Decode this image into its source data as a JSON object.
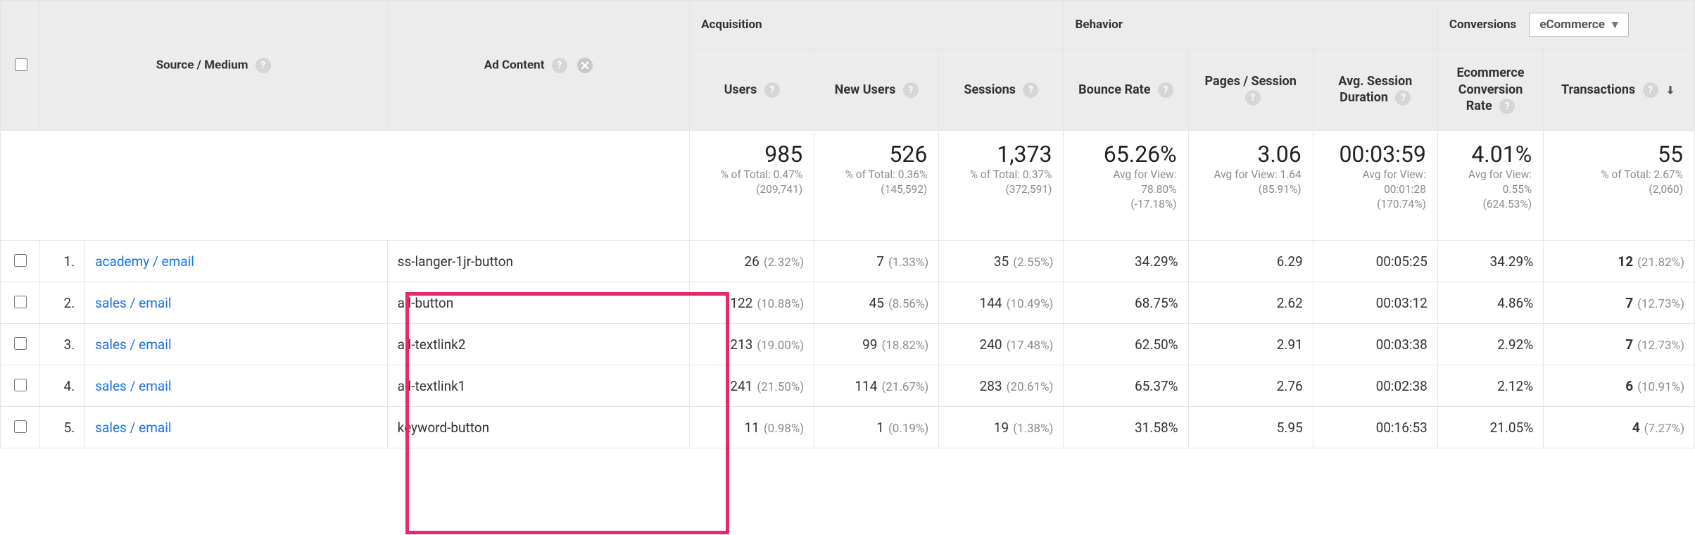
{
  "headers": {
    "checkbox": "",
    "source_medium": "Source / Medium",
    "ad_content": "Ad Content",
    "acquisition": "Acquisition",
    "behavior": "Behavior",
    "conversions": "Conversions",
    "conversions_dropdown": "eCommerce",
    "users": "Users",
    "new_users": "New Users",
    "sessions": "Sessions",
    "bounce_rate": "Bounce Rate",
    "pages_session": "Pages / Session",
    "avg_duration": "Avg. Session Duration",
    "ecr": "Ecommerce Conversion Rate",
    "transactions": "Transactions"
  },
  "totals": {
    "users": {
      "big": "985",
      "sub1": "% of Total: 0.47%",
      "sub2": "(209,741)"
    },
    "new_users": {
      "big": "526",
      "sub1": "% of Total: 0.36%",
      "sub2": "(145,592)"
    },
    "sessions": {
      "big": "1,373",
      "sub1": "% of Total: 0.37%",
      "sub2": "(372,591)"
    },
    "bounce": {
      "big": "65.26%",
      "sub1": "Avg for View: 78.80%",
      "sub2": "(-17.18%)"
    },
    "pages": {
      "big": "3.06",
      "sub1": "Avg for View: 1.64",
      "sub2": "(85.91%)"
    },
    "duration": {
      "big": "00:03:59",
      "sub1": "Avg for View: 00:01:28",
      "sub2": "(170.74%)"
    },
    "ecr": {
      "big": "4.01%",
      "sub1": "Avg for View: 0.55%",
      "sub2": "(624.53%)"
    },
    "trans": {
      "big": "55",
      "sub1": "% of Total: 2.67%",
      "sub2": "(2,060)"
    }
  },
  "rows": [
    {
      "n": "1.",
      "source": "academy / email",
      "ad": "ss-langer-1jr-button",
      "users": "26",
      "users_p": "(2.32%)",
      "new": "7",
      "new_p": "(1.33%)",
      "sess": "35",
      "sess_p": "(2.55%)",
      "bounce": "34.29%",
      "pages": "6.29",
      "dur": "00:05:25",
      "ecr": "34.29%",
      "trans": "12",
      "trans_p": "(21.82%)"
    },
    {
      "n": "2.",
      "source": "sales / email",
      "ad": "all-button",
      "users": "122",
      "users_p": "(10.88%)",
      "new": "45",
      "new_p": "(8.56%)",
      "sess": "144",
      "sess_p": "(10.49%)",
      "bounce": "68.75%",
      "pages": "2.62",
      "dur": "00:03:12",
      "ecr": "4.86%",
      "trans": "7",
      "trans_p": "(12.73%)"
    },
    {
      "n": "3.",
      "source": "sales / email",
      "ad": "all-textlink2",
      "users": "213",
      "users_p": "(19.00%)",
      "new": "99",
      "new_p": "(18.82%)",
      "sess": "240",
      "sess_p": "(17.48%)",
      "bounce": "62.50%",
      "pages": "2.91",
      "dur": "00:03:38",
      "ecr": "2.92%",
      "trans": "7",
      "trans_p": "(12.73%)"
    },
    {
      "n": "4.",
      "source": "sales / email",
      "ad": "all-textlink1",
      "users": "241",
      "users_p": "(21.50%)",
      "new": "114",
      "new_p": "(21.67%)",
      "sess": "283",
      "sess_p": "(20.61%)",
      "bounce": "65.37%",
      "pages": "2.76",
      "dur": "00:02:38",
      "ecr": "2.12%",
      "trans": "6",
      "trans_p": "(10.91%)"
    },
    {
      "n": "5.",
      "source": "sales / email",
      "ad": "keyword-button",
      "users": "11",
      "users_p": "(0.98%)",
      "new": "1",
      "new_p": "(0.19%)",
      "sess": "19",
      "sess_p": "(1.38%)",
      "bounce": "31.58%",
      "pages": "5.95",
      "dur": "00:16:53",
      "ecr": "21.05%",
      "trans": "4",
      "trans_p": "(7.27%)"
    }
  ]
}
